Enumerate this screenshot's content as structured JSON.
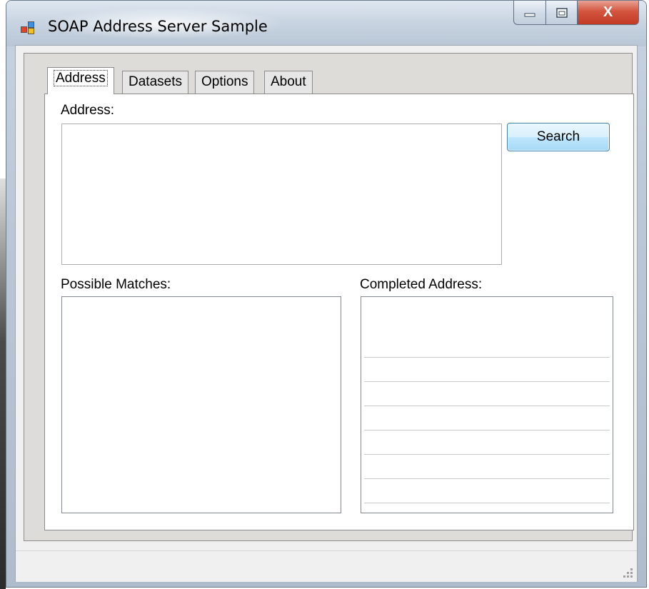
{
  "window": {
    "title": "SOAP Address Server Sample",
    "caption_buttons": {
      "minimize_icon": "minimize-icon",
      "maximize_icon": "maximize-icon",
      "close_label": "X"
    }
  },
  "tabs": [
    {
      "label": "Address",
      "active": true
    },
    {
      "label": "Datasets",
      "active": false
    },
    {
      "label": "Options",
      "active": false
    },
    {
      "label": "About",
      "active": false
    }
  ],
  "address_tab": {
    "address_label": "Address:",
    "address_value": "",
    "search_button": "Search",
    "possible_matches_label": "Possible Matches:",
    "possible_matches_items": [],
    "completed_address_label": "Completed Address:",
    "completed_address_lines": [
      "",
      "",
      "",
      "",
      "",
      "",
      ""
    ]
  },
  "statusbar": {
    "text": ""
  },
  "colors": {
    "client_background": "#f0f0f0",
    "tab_panel_background": "#ffffff",
    "close_button": "#c23a24",
    "search_button_border": "#3c7fb1"
  }
}
